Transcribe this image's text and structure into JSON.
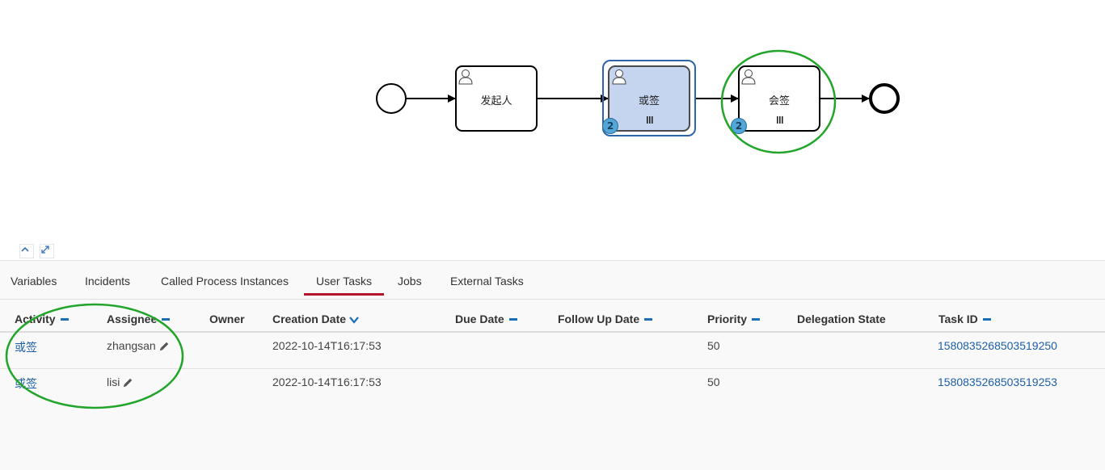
{
  "diagram": {
    "tasks": [
      {
        "label": "发起人",
        "badge": null
      },
      {
        "label": "或签",
        "badge": "2"
      },
      {
        "label": "会签",
        "badge": "2"
      }
    ],
    "colors": {
      "selected_fill": "#c6d5ef",
      "selected_border": "#2e65a9",
      "annotation": "#22a52a"
    }
  },
  "tabs": [
    {
      "label": "Variables"
    },
    {
      "label": "Incidents"
    },
    {
      "label": "Called Process Instances"
    },
    {
      "label": "User Tasks"
    },
    {
      "label": "Jobs"
    },
    {
      "label": "External Tasks"
    }
  ],
  "active_tab": "User Tasks",
  "table": {
    "columns": [
      "Activity",
      "Assignee",
      "Owner",
      "Creation Date",
      "Due Date",
      "Follow Up Date",
      "Priority",
      "Delegation State",
      "Task ID"
    ],
    "rows": [
      {
        "activity": "或签",
        "assignee": "zhangsan",
        "owner": "",
        "creation_date": "2022-10-14T16:17:53",
        "due_date": "",
        "follow_up_date": "",
        "priority": "50",
        "delegation_state": "",
        "task_id": "1580835268503519250"
      },
      {
        "activity": "或签",
        "assignee": "lisi",
        "owner": "",
        "creation_date": "2022-10-14T16:17:53",
        "due_date": "",
        "follow_up_date": "",
        "priority": "50",
        "delegation_state": "",
        "task_id": "1580835268503519253"
      }
    ]
  },
  "icons": [
    "user-task-icon",
    "multi-instance-parallel-icon",
    "collapse-icon",
    "expand-icon",
    "sort-minus-icon",
    "sort-desc-icon",
    "pencil-icon"
  ]
}
